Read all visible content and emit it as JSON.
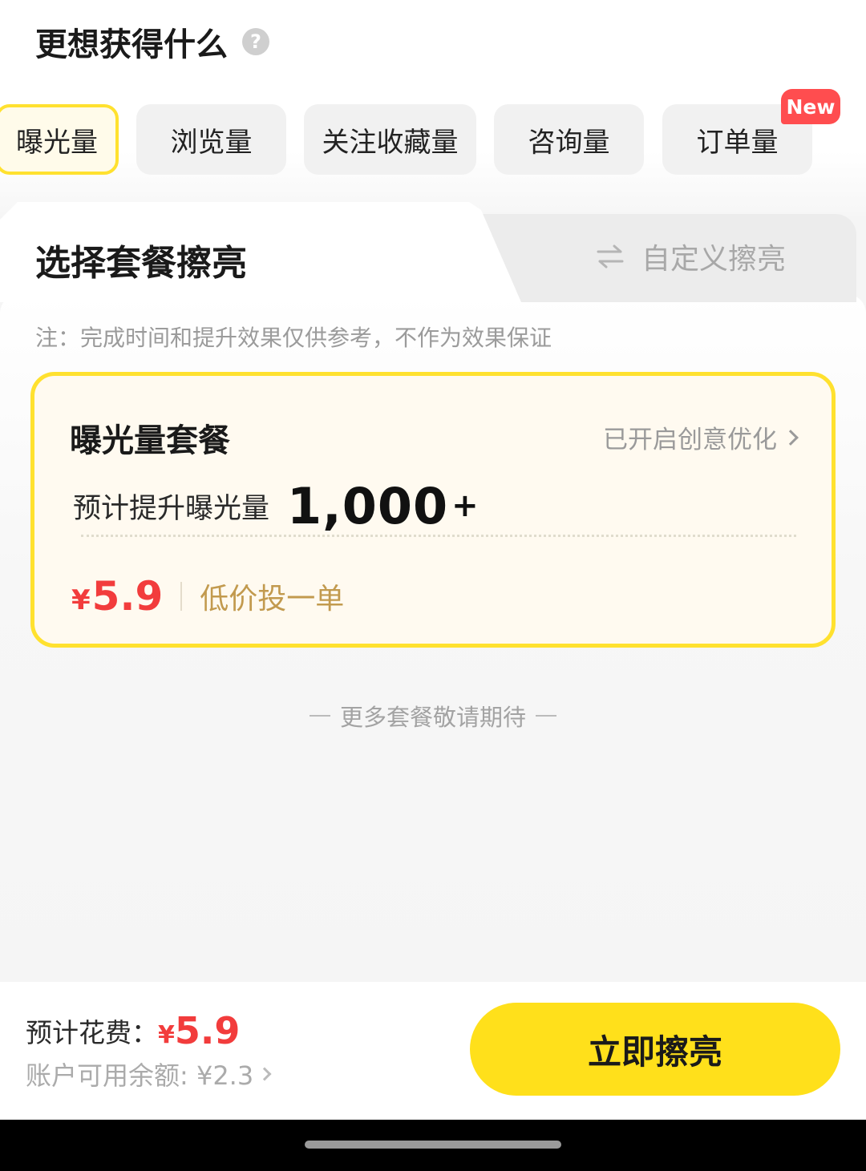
{
  "header": {
    "title": "更想获得什么",
    "help_icon": "help-icon"
  },
  "goal_tabs": [
    {
      "label": "曝光量",
      "active": true
    },
    {
      "label": "浏览量",
      "active": false
    },
    {
      "label": "关注收藏量",
      "active": false
    },
    {
      "label": "咨询量",
      "active": false
    },
    {
      "label": "订单量",
      "active": false,
      "badge": "New"
    }
  ],
  "mode_tabs": {
    "package_label": "选择套餐擦亮",
    "custom_label": "自定义擦亮",
    "custom_icon": "swap-icon"
  },
  "note": "注：完成时间和提升效果仅供参考，不作为效果保证",
  "package": {
    "title": "曝光量套餐",
    "link_label": "已开启创意优化",
    "estimate_label": "预计提升曝光量",
    "estimate_value": "1,000",
    "estimate_suffix": "+",
    "price_symbol": "¥",
    "price_value": "5.9",
    "price_tag": "低价投一单"
  },
  "more_hint": "更多套餐敬请期待",
  "footer": {
    "cost_label": "预计花费：",
    "cost_symbol": "¥",
    "cost_value": "5.9",
    "balance_label": "账户可用余额: ¥2.3",
    "cta_label": "立即擦亮"
  },
  "colors": {
    "accent_yellow": "#ffe01b",
    "price_red": "#f23c3c",
    "badge_red": "#ff4d4f"
  }
}
